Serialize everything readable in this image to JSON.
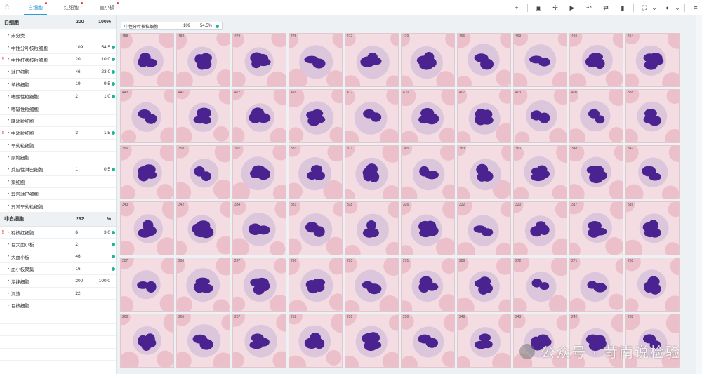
{
  "tabs": [
    {
      "label": "白细胞",
      "active": true
    },
    {
      "label": "红细胞",
      "active": false
    },
    {
      "label": "血小板",
      "active": false
    }
  ],
  "tools": [
    "plus-icon",
    "save-icon",
    "adjust-icon",
    "video-icon",
    "undo-icon",
    "transfer-icon",
    "bookmark-icon",
    "fit-icon",
    "chevron-down-icon",
    "palette-icon",
    "chevron-down-icon",
    "menu-icon"
  ],
  "wbc": {
    "header": {
      "name": "白细胞",
      "count": "200",
      "pct": "100%"
    },
    "rows": [
      {
        "flag": "",
        "name": "未分类",
        "count": "",
        "pct": "",
        "dot": false
      },
      {
        "flag": "",
        "name": "中性分叶核粒细胞",
        "count": "109",
        "pct": "54.5",
        "dot": true
      },
      {
        "flag": "!",
        "name": "中性杆状核粒细胞",
        "count": "20",
        "pct": "10.0",
        "dot": true
      },
      {
        "flag": "",
        "name": "淋巴细胞",
        "count": "46",
        "pct": "23.0",
        "dot": true
      },
      {
        "flag": "",
        "name": "单核细胞",
        "count": "19",
        "pct": "9.5",
        "dot": true
      },
      {
        "flag": "",
        "name": "嗜酸性粒细胞",
        "count": "2",
        "pct": "1.0",
        "dot": true
      },
      {
        "flag": "",
        "name": "嗜碱性粒细胞",
        "count": "",
        "pct": "",
        "dot": false
      },
      {
        "flag": "",
        "name": "晚幼粒细胞",
        "count": "",
        "pct": "",
        "dot": false
      },
      {
        "flag": "!",
        "name": "中幼粒细胞",
        "count": "3",
        "pct": "1.5",
        "dot": true
      },
      {
        "flag": "",
        "name": "早幼粒细胞",
        "count": "",
        "pct": "",
        "dot": false
      },
      {
        "flag": "",
        "name": "原始细胞",
        "count": "",
        "pct": "",
        "dot": false
      },
      {
        "flag": "",
        "name": "反应性淋巴细胞",
        "count": "1",
        "pct": "0.5",
        "dot": true
      },
      {
        "flag": "",
        "name": "浆细胞",
        "count": "",
        "pct": "",
        "dot": false
      },
      {
        "flag": "",
        "name": "异常淋巴细胞",
        "count": "",
        "pct": "",
        "dot": false
      },
      {
        "flag": "",
        "name": "异常早幼粒细胞",
        "count": "",
        "pct": "",
        "dot": false
      }
    ]
  },
  "nonwbc": {
    "header": {
      "name": "非白细胞",
      "count": "292",
      "pct": "%"
    },
    "rows": [
      {
        "flag": "!",
        "name": "有核红细胞",
        "count": "6",
        "pct": "3.0",
        "dot": true
      },
      {
        "flag": "",
        "name": "巨大血小板",
        "count": "2",
        "pct": "",
        "dot": true
      },
      {
        "flag": "",
        "name": "大血小板",
        "count": "46",
        "pct": "",
        "dot": true
      },
      {
        "flag": "",
        "name": "血小板聚集",
        "count": "16",
        "pct": "",
        "dot": true
      },
      {
        "flag": "",
        "name": "涂抹细胞",
        "count": "200",
        "pct": "100.0",
        "dot": false
      },
      {
        "flag": "",
        "name": "沉渣",
        "count": "22",
        "pct": "",
        "dot": false
      },
      {
        "flag": "",
        "name": "巨核细胞",
        "count": "",
        "pct": "",
        "dot": false
      }
    ]
  },
  "selected": {
    "name": "中性分叶核粒细胞",
    "count": "109",
    "pct": "54.5%"
  },
  "cells": [
    "488",
    "482",
    "479",
    "475",
    "472",
    "470",
    "466",
    "463",
    "460",
    "454",
    "443",
    "441",
    "427",
    "418",
    "417",
    "410",
    "407",
    "403",
    "400",
    "388",
    "396",
    "393",
    "391",
    "381",
    "371",
    "365",
    "363",
    "360",
    "348",
    "347",
    "343",
    "342",
    "334",
    "331",
    "328",
    "326",
    "322",
    "320",
    "317",
    "316",
    "307",
    "298",
    "297",
    "296",
    "293",
    "291",
    "289",
    "272",
    "271",
    "268",
    "266",
    "265",
    "257",
    "252",
    "251",
    "250",
    "248",
    "243",
    "242",
    "238"
  ],
  "colors": {
    "accent": "#2a9bd8",
    "status": "#1fb39a",
    "flag": "#e03030",
    "nucleus": "#4a2390"
  },
  "watermark": "公众号 · 苛南说检验"
}
